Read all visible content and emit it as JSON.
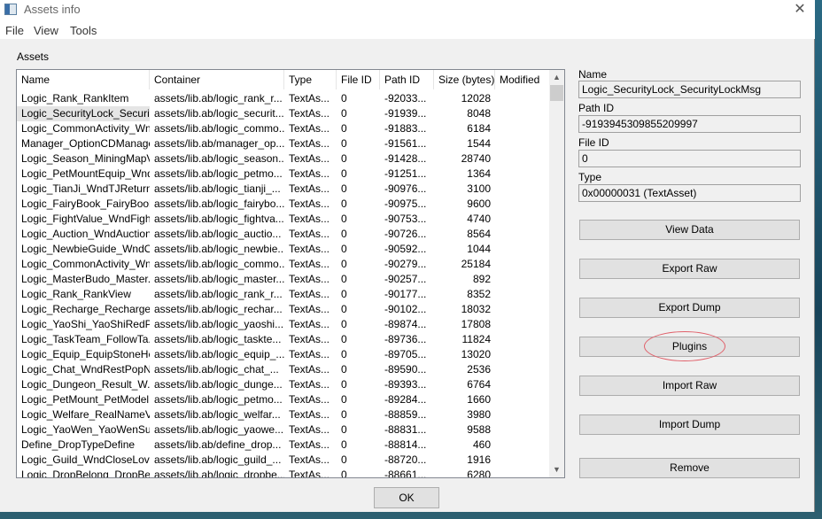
{
  "window": {
    "title": "Assets info",
    "close_icon": "close-icon"
  },
  "menu": [
    "File",
    "View",
    "Tools"
  ],
  "assets_label": "Assets",
  "columns": [
    "Name",
    "Container",
    "Type",
    "File ID",
    "Path ID",
    "Size (bytes)",
    "Modified"
  ],
  "rows": [
    [
      "Logic_Rank_RankItem",
      "assets/lib.ab/logic_rank_r...",
      "TextAs...",
      "0",
      "-92033...",
      "12028",
      ""
    ],
    [
      "Logic_SecurityLock_Securit...",
      "assets/lib.ab/logic_securit...",
      "TextAs...",
      "0",
      "-91939...",
      "8048",
      ""
    ],
    [
      "Logic_CommonActivity_Wn...",
      "assets/lib.ab/logic_commo...",
      "TextAs...",
      "0",
      "-91883...",
      "6184",
      ""
    ],
    [
      "Manager_OptionCDManager",
      "assets/lib.ab/manager_op...",
      "TextAs...",
      "0",
      "-91561...",
      "1544",
      ""
    ],
    [
      "Logic_Season_MiningMapVi...",
      "assets/lib.ab/logic_season...",
      "TextAs...",
      "0",
      "-91428...",
      "28740",
      ""
    ],
    [
      "Logic_PetMountEquip_Wnd...",
      "assets/lib.ab/logic_petmo...",
      "TextAs...",
      "0",
      "-91251...",
      "1364",
      ""
    ],
    [
      "Logic_TianJi_WndTJReturn...",
      "assets/lib.ab/logic_tianji_...",
      "TextAs...",
      "0",
      "-90976...",
      "3100",
      ""
    ],
    [
      "Logic_FairyBook_FairyBook...",
      "assets/lib.ab/logic_fairybo...",
      "TextAs...",
      "0",
      "-90975...",
      "9600",
      ""
    ],
    [
      "Logic_FightValue_WndFigh...",
      "assets/lib.ab/logic_fightva...",
      "TextAs...",
      "0",
      "-90753...",
      "4740",
      ""
    ],
    [
      "Logic_Auction_WndAuction...",
      "assets/lib.ab/logic_auctio...",
      "TextAs...",
      "0",
      "-90726...",
      "8564",
      ""
    ],
    [
      "Logic_NewbieGuide_WndO...",
      "assets/lib.ab/logic_newbie...",
      "TextAs...",
      "0",
      "-90592...",
      "1044",
      ""
    ],
    [
      "Logic_CommonActivity_Wn...",
      "assets/lib.ab/logic_commo...",
      "TextAs...",
      "0",
      "-90279...",
      "25184",
      ""
    ],
    [
      "Logic_MasterBudo_Master...",
      "assets/lib.ab/logic_master...",
      "TextAs...",
      "0",
      "-90257...",
      "892",
      ""
    ],
    [
      "Logic_Rank_RankView",
      "assets/lib.ab/logic_rank_r...",
      "TextAs...",
      "0",
      "-90177...",
      "8352",
      ""
    ],
    [
      "Logic_Recharge_Recharge...",
      "assets/lib.ab/logic_rechar...",
      "TextAs...",
      "0",
      "-90102...",
      "18032",
      ""
    ],
    [
      "Logic_YaoShi_YaoShiRedP...",
      "assets/lib.ab/logic_yaoshi...",
      "TextAs...",
      "0",
      "-89874...",
      "17808",
      ""
    ],
    [
      "Logic_TaskTeam_FollowTa...",
      "assets/lib.ab/logic_taskte...",
      "TextAs...",
      "0",
      "-89736...",
      "11824",
      ""
    ],
    [
      "Logic_Equip_EquipStoneHe...",
      "assets/lib.ab/logic_equip_...",
      "TextAs...",
      "0",
      "-89705...",
      "13020",
      ""
    ],
    [
      "Logic_Chat_WndRestPopN...",
      "assets/lib.ab/logic_chat_...",
      "TextAs...",
      "0",
      "-89590...",
      "2536",
      ""
    ],
    [
      "Logic_Dungeon_Result_W...",
      "assets/lib.ab/logic_dunge...",
      "TextAs...",
      "0",
      "-89393...",
      "6764",
      ""
    ],
    [
      "Logic_PetMount_PetModel",
      "assets/lib.ab/logic_petmo...",
      "TextAs...",
      "0",
      "-89284...",
      "1660",
      ""
    ],
    [
      "Logic_Welfare_RealNameVi...",
      "assets/lib.ab/logic_welfar...",
      "TextAs...",
      "0",
      "-88859...",
      "3980",
      ""
    ],
    [
      "Logic_YaoWen_YaoWenSui...",
      "assets/lib.ab/logic_yaowe...",
      "TextAs...",
      "0",
      "-88831...",
      "9588",
      ""
    ],
    [
      "Define_DropTypeDefine",
      "assets/lib.ab/define_drop...",
      "TextAs...",
      "0",
      "-88814...",
      "460",
      ""
    ],
    [
      "Logic_Guild_WndCloseLover",
      "assets/lib.ab/logic_guild_...",
      "TextAs...",
      "0",
      "-88720...",
      "1916",
      ""
    ],
    [
      "Logic_DropBelong_DropBel...",
      "assets/lib.ab/logic_dropbe...",
      "TextAs...",
      "0",
      "-88661...",
      "6280",
      ""
    ]
  ],
  "selected_row": 1,
  "details": {
    "name_label": "Name",
    "name_value": "Logic_SecurityLock_SecurityLockMsg",
    "pathid_label": "Path ID",
    "pathid_value": "-9193945309855209997",
    "fileid_label": "File ID",
    "fileid_value": "0",
    "type_label": "Type",
    "type_value": "0x00000031 (TextAsset)"
  },
  "buttons": {
    "view_data": "View Data",
    "export_raw": "Export Raw",
    "export_dump": "Export Dump",
    "plugins": "Plugins",
    "import_raw": "Import Raw",
    "import_dump": "Import Dump",
    "remove": "Remove",
    "ok": "OK"
  },
  "highlight_color": "#e0606a"
}
